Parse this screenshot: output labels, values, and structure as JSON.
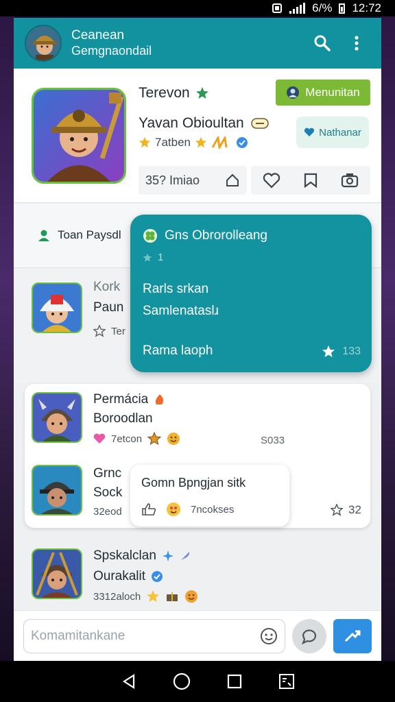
{
  "status": {
    "time": "12:72",
    "battery": "6/%"
  },
  "appbar": {
    "title": "Ceanean",
    "subtitle": "Gemgnaondail"
  },
  "hero": {
    "title": "Terevon",
    "name": "Yavan Obioultan",
    "meta": "7atben",
    "primary_btn": "Menunitan",
    "secondary_btn": "Nathanar",
    "stat": "35? Imiao"
  },
  "section": {
    "label": "Toan Paysdl"
  },
  "teal_card": {
    "title": "Gns Obrorolleang",
    "sub": "1",
    "line1": "Rarls srkan",
    "line2": "Samlenataslɹ",
    "line3": "Rama laoph",
    "count": "133"
  },
  "items": [
    {
      "name1": "Kork",
      "name2": "Paun",
      "meta": "Ter"
    },
    {
      "name1": "Permácia",
      "name2": "Boroodlan",
      "meta": "7etcon",
      "right": "S033"
    },
    {
      "name1": "Grnc",
      "name2": "Sock",
      "meta": "32eod",
      "right": "32"
    },
    {
      "name1": "Spskalclan",
      "name2": "Ourakalit",
      "meta": "3312aloch"
    }
  ],
  "bubble": {
    "title": "Gomn Bpngjan sitk",
    "meta": "7ncokses"
  },
  "composer": {
    "placeholder": "Komamitankane"
  },
  "colors": {
    "teal": "#13929f",
    "green": "#7cba35",
    "blue": "#2f8fe0"
  }
}
